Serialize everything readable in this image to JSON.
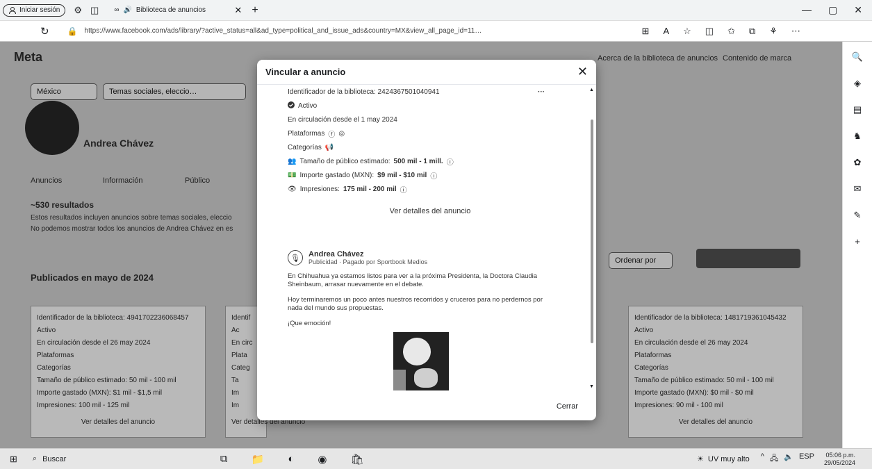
{
  "browser": {
    "signin_label": "Iniciar sesión",
    "tab_title": "Biblioteca de anuncios",
    "url": "https://www.facebook.com/ads/library/?active_status=all&ad_type=political_and_issue_ads&country=MX&view_all_page_id=11…",
    "window_controls": [
      "—",
      "▢",
      "✕"
    ]
  },
  "background": {
    "logo": "Meta",
    "nav_links": [
      "Acerca de la biblioteca de anuncios",
      "Contenido de marca"
    ],
    "filters": [
      "México",
      "Temas sociales, eleccio…"
    ],
    "profile_name": "Andrea Chávez",
    "tabs": [
      "Anuncios",
      "Información",
      "Público"
    ],
    "results": "~530 resultados",
    "notice1": "Estos resultados incluyen anuncios sobre temas sociales, eleccio",
    "notice2": "No podemos mostrar todos los anuncios de Andrea Chávez en es",
    "section_title": "Publicados en mayo de 2024",
    "sort_label": "Ordenar por",
    "cards": [
      {
        "id": "Identificador de la biblioteca: 4941702236068457",
        "status": "Activo",
        "since": "En circulación desde el 26 may 2024",
        "platforms": "Plataformas",
        "categories": "Categorías",
        "audience": "Tamaño de público estimado: 50 mil - 100 mil",
        "spend": "Importe gastado (MXN): $1 mil - $1,5 mil",
        "impressions": "Impresiones: 100 mil - 125 mil",
        "link": "Ver detalles del anuncio"
      },
      {
        "id": "Identif",
        "status": "Ac",
        "since": "En circ",
        "platforms": "Plata",
        "categories": "Categ",
        "audience": "Ta",
        "spend": "Im",
        "impressions": "Im",
        "link": "Ver detalles del anuncio"
      },
      {
        "id": "Identificador de la biblioteca: 1481719361045432",
        "status": "Activo",
        "since": "En circulación desde el 26 may 2024",
        "platforms": "Plataformas",
        "categories": "Categorías",
        "audience": "Tamaño de público estimado: 50 mil - 100 mil",
        "spend": "Importe gastado (MXN): $0 mil - $0 mil",
        "impressions": "Impresiones: 90 mil - 100 mil",
        "link": "Ver detalles del anuncio"
      }
    ]
  },
  "modal": {
    "title": "Vincular a anuncio",
    "library_id": "Identificador de la biblioteca: 2424367501040941",
    "status": "Activo",
    "since": "En circulación desde el 1 may 2024",
    "platforms_label": "Plataformas",
    "categories_label": "Categorías",
    "audience_label": "Tamaño de público estimado:",
    "audience_value": "500 mil - 1 mill.",
    "spend_label": "Importe gastado (MXN):",
    "spend_value": "$9 mil - $10 mil",
    "impressions_label": "Impresiones:",
    "impressions_value": "175 mil - 200 mil",
    "details_link": "Ver detalles del anuncio",
    "advertiser_name": "Andrea Chávez",
    "advertiser_sub": "Publicidad · Pagado por Sportbook Medios",
    "para1": "En Chihuahua ya estamos listos para ver a la próxima Presidenta, la Doctora Claudia Sheinbaum, arrasar nuevamente en el debate.",
    "para2": "Hoy terminaremos un poco antes nuestros recorridos y cruceros para no perdernos por nada del mundo sus propuestas.",
    "para3": "¡Que emoción!",
    "close_label": "Cerrar"
  },
  "taskbar": {
    "search_placeholder": "Buscar",
    "weather": "UV muy alto",
    "lang": "ESP",
    "time": "05:06 p.m.",
    "date": "29/05/2024"
  }
}
